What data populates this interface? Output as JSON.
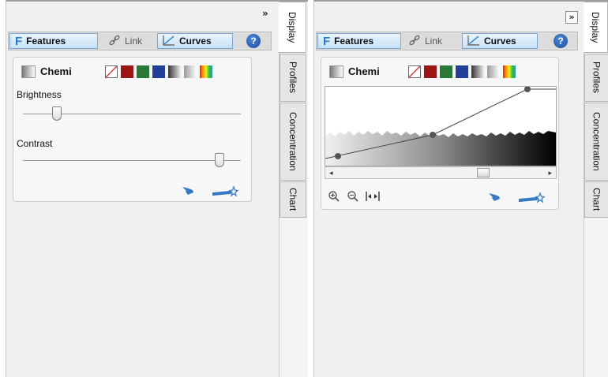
{
  "left_panel": {
    "expand_label": "»",
    "tabs": {
      "features": "Features",
      "link": "Link",
      "curves": "Curves",
      "help": "?"
    },
    "channel": {
      "name": "Chemi"
    },
    "brightness": {
      "label": "Brightness",
      "value": 0.14
    },
    "contrast": {
      "label": "Contrast",
      "value": 0.92
    }
  },
  "right_panel": {
    "expand_label": "»",
    "tabs": {
      "features": "Features",
      "link": "Link",
      "curves": "Curves",
      "help": "?"
    },
    "channel": {
      "name": "Chemi"
    },
    "scroll_position": 0.72
  },
  "side_tabs": [
    "Display",
    "Profiles",
    "Concentration",
    "Chart"
  ],
  "colors": {
    "accent_blue": "#2a78c8",
    "swatch_red": "#9c1515",
    "swatch_green": "#2a7a35",
    "swatch_blue": "#22409a",
    "icon_blue": "#3478c4"
  },
  "icons": {
    "features": "features-f-icon",
    "link": "link-icon",
    "curves": "curves-icon",
    "help": "help-icon",
    "hand": "hand-pointer-icon",
    "wand": "magic-wand-icon",
    "zoom_in": "zoom-in-icon",
    "zoom_out": "zoom-out-icon",
    "fit": "fit-width-icon"
  }
}
